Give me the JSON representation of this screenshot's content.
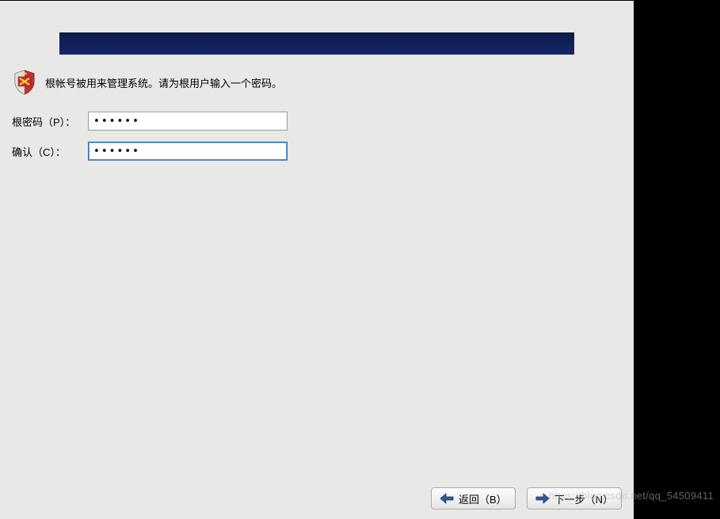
{
  "instruction": "根帐号被用来管理系统。请为根用户输入一个密码。",
  "form": {
    "password_label": "根密码（P）：",
    "password_value": "••••••",
    "confirm_label": "确认（C）：",
    "confirm_value": "••••••"
  },
  "buttons": {
    "back_label": "返回（B）",
    "next_label": "下一步（N）"
  },
  "watermark": "https://blog.csdn.net/qq_54509411"
}
